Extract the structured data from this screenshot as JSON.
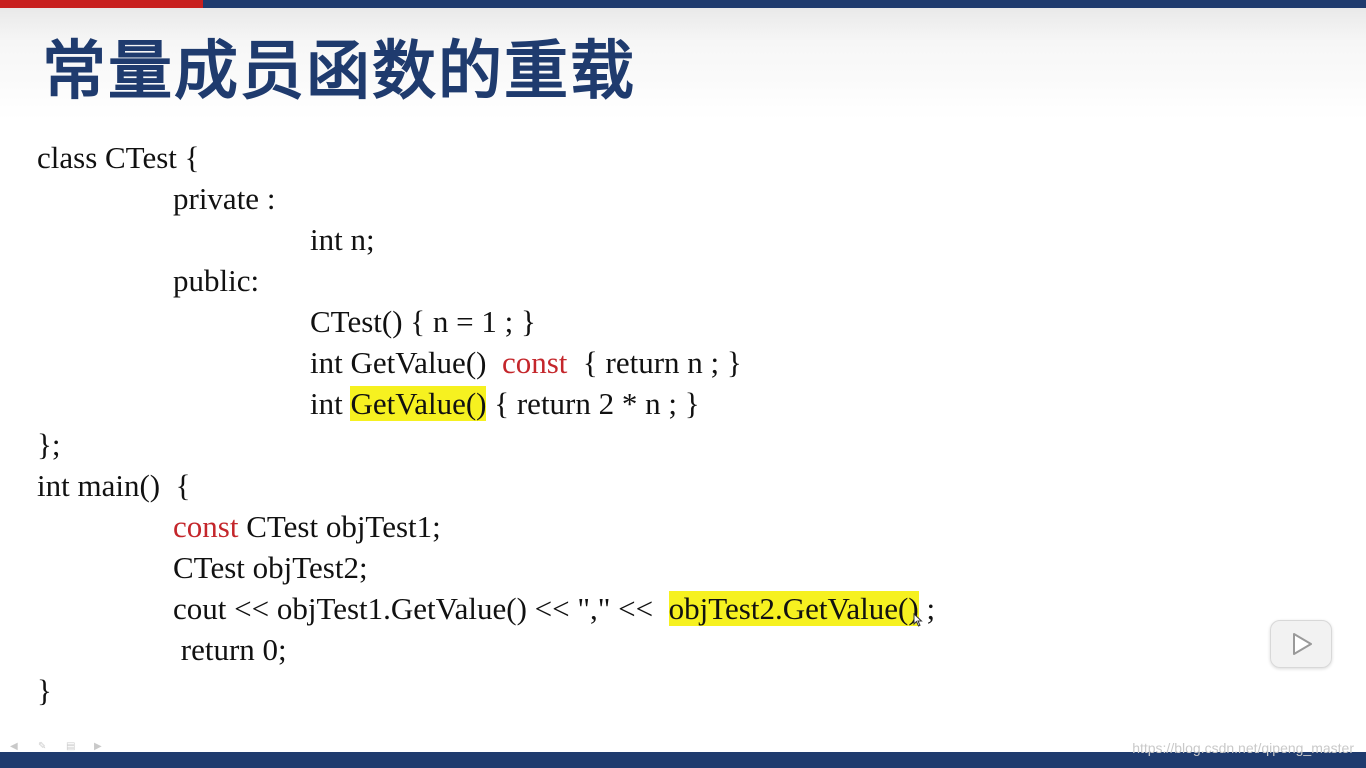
{
  "slide": {
    "title": "常量成员函数的重载",
    "watermark": "https://blog.csdn.net/qipeng_master"
  },
  "code": {
    "l1": "class CTest {",
    "l2": "private :",
    "l3": "int n;",
    "l4": "public:",
    "l5": "CTest() { n = 1 ; }",
    "l6a": "int GetValue()  ",
    "l6b": "const",
    "l6c": "  { return n ; }",
    "l7a": "int ",
    "l7b": "GetValue()",
    "l7c": " { return 2 * n ; }",
    "l8": "};",
    "l9": "int main()  {",
    "l10a": "const",
    "l10b": " CTest objTest1;",
    "l11": "CTest objTest2;",
    "l12a": "cout << objTest1.GetValue() << \",\" <<  ",
    "l12b": "objTest2.GetValue()",
    "l12c": " ;",
    "l13": " return 0;",
    "l14": "}"
  },
  "colors": {
    "title": "#1f3b6e",
    "keyword_const": "#c4262b",
    "highlight": "#f6f120",
    "accent_red": "#c8201f",
    "bar_navy": "#1f3b6e"
  },
  "icons": {
    "play": "play-icon",
    "cursor": "mouse-cursor-icon"
  }
}
